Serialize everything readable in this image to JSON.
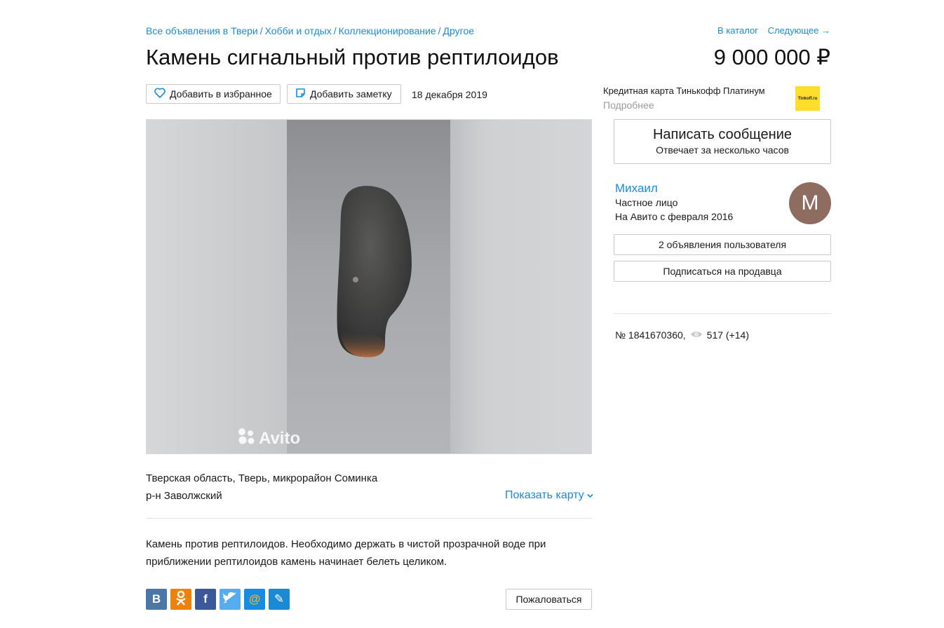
{
  "breadcrumb": {
    "items": [
      "Все объявления в Твери",
      "Хобби и отдых",
      "Коллекционирование",
      "Другое"
    ],
    "separator": "/"
  },
  "topnav": {
    "catalog": "В каталог",
    "next": "Следующее →"
  },
  "listing": {
    "title": "Камень сигнальный против рептилоидов",
    "price": "9 000 000 ₽",
    "date": "18 декабря 2019",
    "address_line1": "Тверская область, Тверь, микрорайон Соминка",
    "address_line2": "р-н Заволжский",
    "description": "Камень против рептилоидов. Необходимо держать в чистой прозрачной воде при приближении рептилоидов камень начинает белеть целиком.",
    "id_text": "№ 1841670360,",
    "views": "517 (+14)"
  },
  "actions": {
    "favorite": "Добавить в избранное",
    "note": "Добавить заметку",
    "show_map": "Показать карту",
    "complain": "Пожаловаться"
  },
  "photo": {
    "watermark": "Avito"
  },
  "ad": {
    "title": "Кредитная карта Тинькофф Платинум",
    "more": "Подробнее",
    "logo_text": "Tinkoff.ru"
  },
  "contact": {
    "write": "Написать сообщение",
    "reply_time": "Отвечает за несколько часов"
  },
  "seller": {
    "name": "Михаил",
    "type": "Частное лицо",
    "since": "На Авито с февраля 2016",
    "avatar_letter": "M",
    "listings": "2 объявления пользователя",
    "subscribe": "Подписаться на продавца"
  },
  "share": {
    "buttons": [
      {
        "name": "vk",
        "glyph": "B",
        "color": "#4a76a8"
      },
      {
        "name": "odnoklassniki",
        "glyph": "ok",
        "color": "#ee8208"
      },
      {
        "name": "facebook",
        "glyph": "f",
        "color": "#3b5998"
      },
      {
        "name": "twitter",
        "glyph": "t",
        "color": "#55acee"
      },
      {
        "name": "mailru",
        "glyph": "@",
        "color": "#168de2"
      },
      {
        "name": "livejournal",
        "glyph": "✎",
        "color": "#1c8ad2"
      }
    ]
  },
  "colors": {
    "link": "#1c8ad2",
    "accent_yellow": "#ffdd2d",
    "avatar": "#8e6d60"
  }
}
